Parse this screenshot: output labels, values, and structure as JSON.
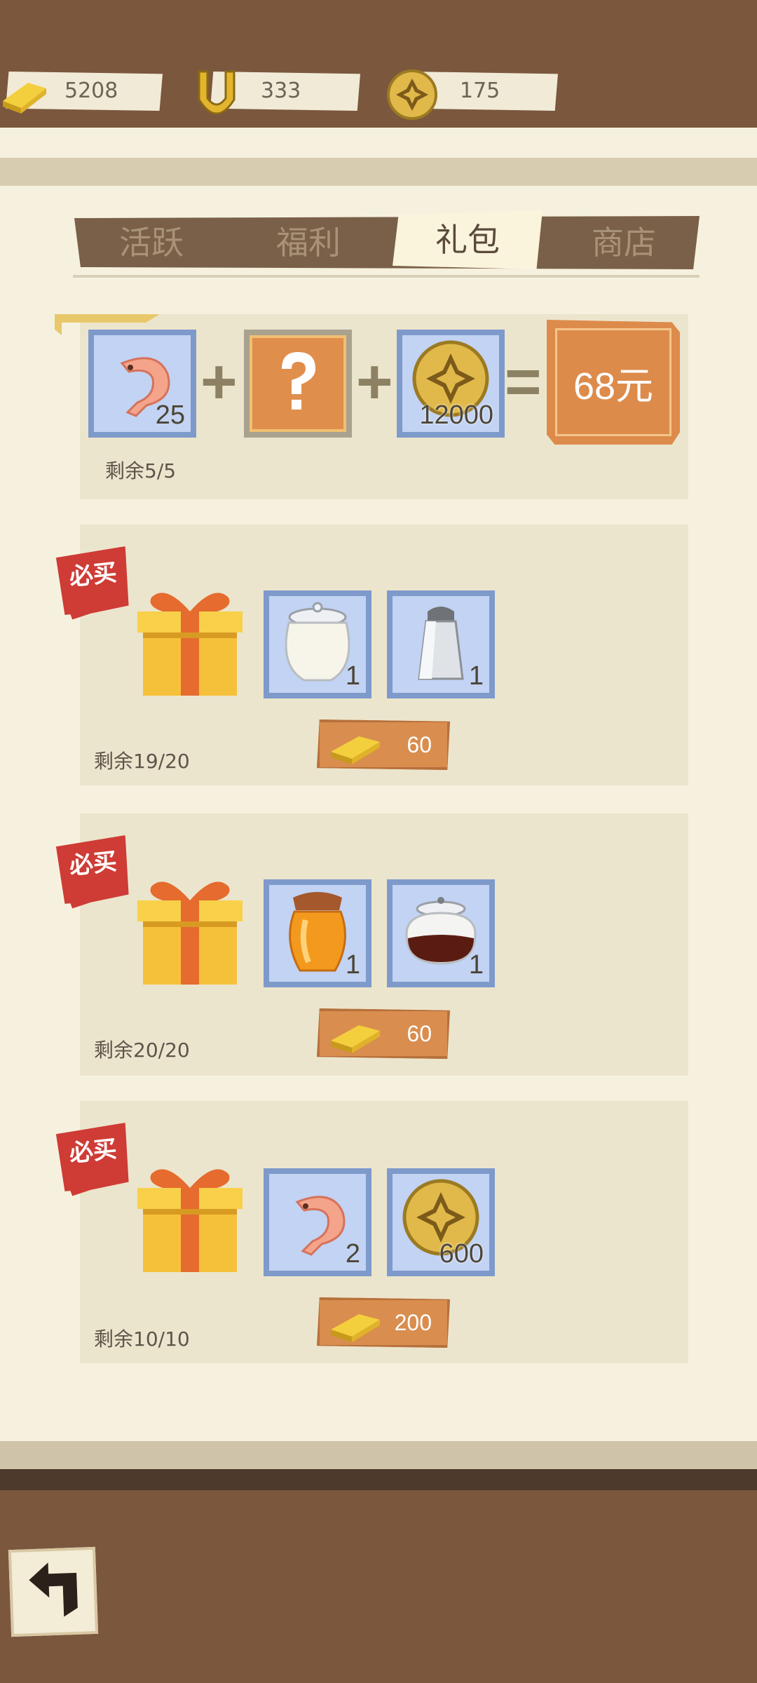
{
  "resources": [
    {
      "name": "gold-bar-icon",
      "value": "5208"
    },
    {
      "name": "horseshoe-icon",
      "value": "333"
    },
    {
      "name": "coin-icon",
      "value": "175"
    }
  ],
  "tabs": [
    {
      "label": "活跃",
      "active": false
    },
    {
      "label": "福利",
      "active": false
    },
    {
      "label": "礼包",
      "active": true
    },
    {
      "label": "商店",
      "active": false
    }
  ],
  "bundle": {
    "items": [
      {
        "icon": "shrimp-icon",
        "count": "25"
      },
      {
        "icon": "mystery-box-icon",
        "count": ""
      },
      {
        "icon": "coin-icon",
        "count": "12000"
      }
    ],
    "price": "68元",
    "remaining": "剩余5/5"
  },
  "packs": [
    {
      "badge": "必买",
      "items": [
        {
          "icon": "sugar-jar-icon",
          "count": "1"
        },
        {
          "icon": "salt-shaker-icon",
          "count": "1"
        }
      ],
      "price": "60",
      "remaining": "剩余19/20"
    },
    {
      "badge": "必买",
      "items": [
        {
          "icon": "honey-jar-icon",
          "count": "1"
        },
        {
          "icon": "soy-sauce-jar-icon",
          "count": "1"
        }
      ],
      "price": "60",
      "remaining": "剩余20/20"
    },
    {
      "badge": "必买",
      "items": [
        {
          "icon": "shrimp-icon",
          "count": "2"
        },
        {
          "icon": "coin-icon",
          "count": "600"
        }
      ],
      "price": "200",
      "remaining": "剩余10/10"
    }
  ],
  "colors": {
    "background": "#7a573d",
    "paper": "#f6f1df",
    "slot_border": "#7e9acb",
    "price_orange": "#dd8b4b",
    "badge_red": "#cf3b35"
  }
}
